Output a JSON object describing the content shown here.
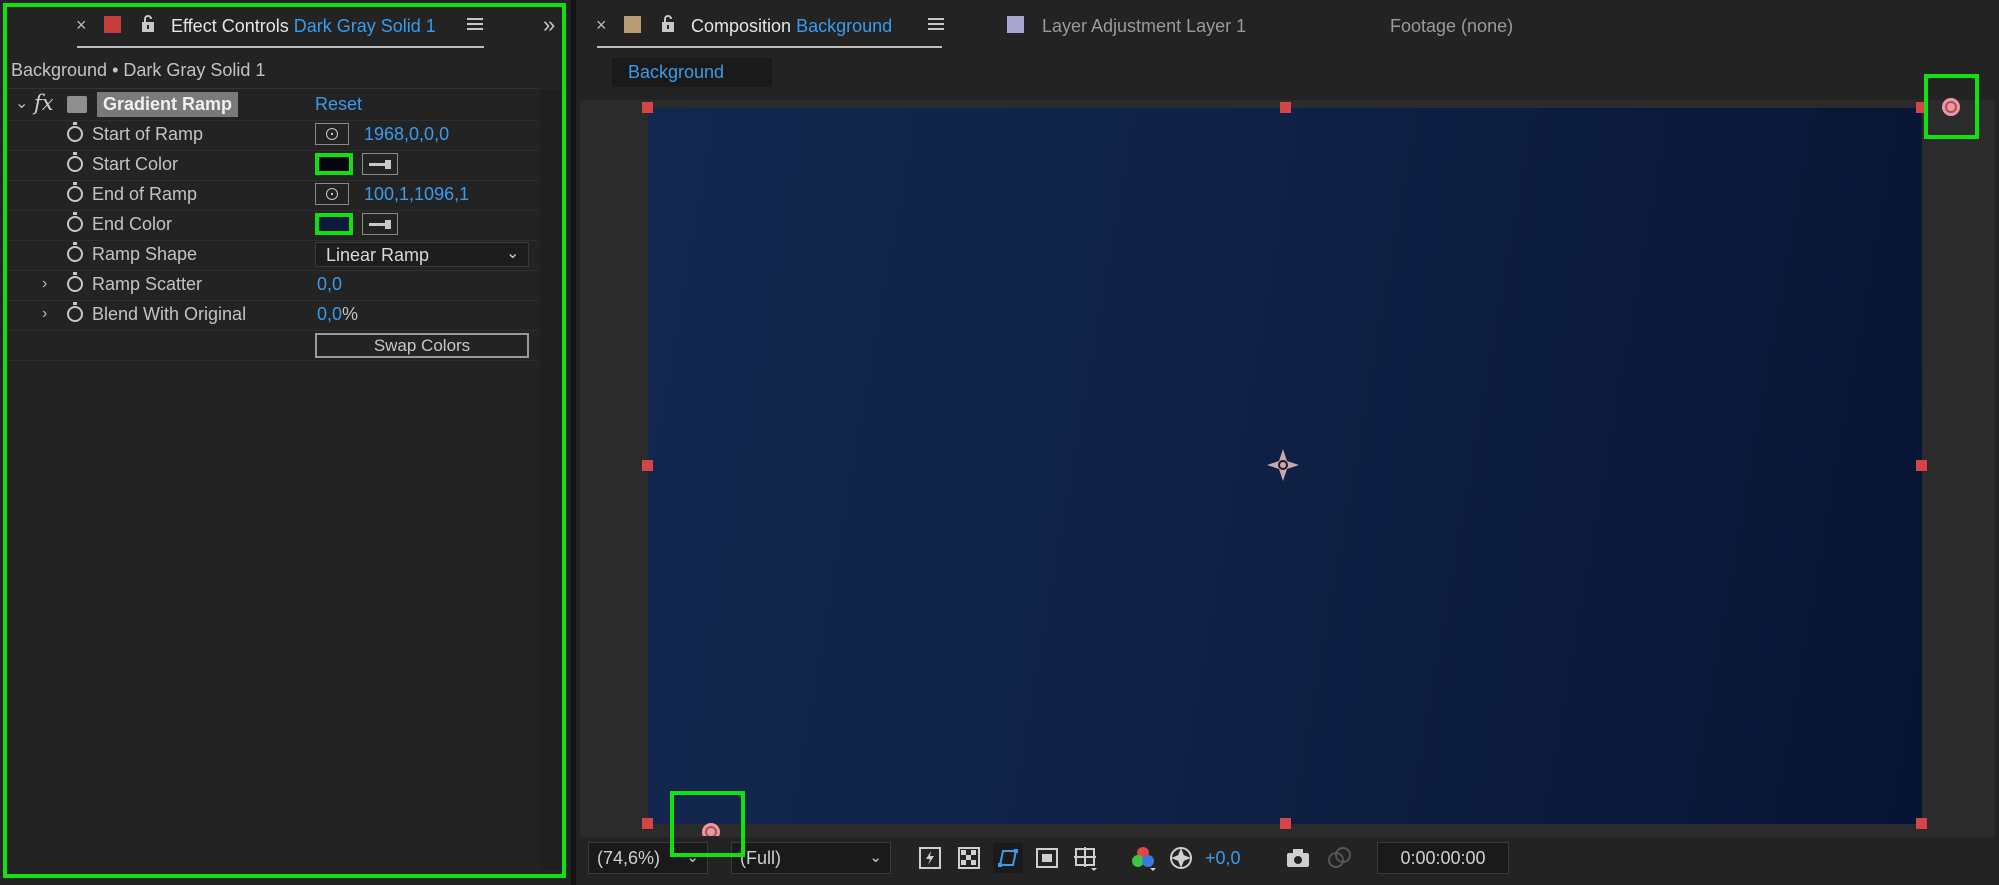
{
  "effect_controls": {
    "tab_title": "Effect Controls",
    "tab_layer": "Dark Gray Solid 1",
    "breadcrumb": "Background • Dark Gray Solid 1",
    "effect_name": "Gradient Ramp",
    "reset_label": "Reset",
    "properties": [
      {
        "label": "Start of Ramp",
        "value": "1968,0,0,0"
      },
      {
        "label": "Start Color",
        "color": "#05060d"
      },
      {
        "label": "End of Ramp",
        "value": "100,1,1096,1"
      },
      {
        "label": "End Color",
        "color": "#0c1a3b"
      },
      {
        "label": "Ramp Shape",
        "value": "Linear Ramp"
      },
      {
        "label": "Ramp Scatter",
        "value": "0,0"
      },
      {
        "label": "Blend With Original",
        "value": "0,0",
        "unit": "%"
      }
    ],
    "swap_colors_label": "Swap Colors"
  },
  "composition": {
    "tab_title": "Composition",
    "tab_comp": "Background",
    "layer_tab": "Layer Adjustment Layer 1",
    "footage_tab": "Footage (none)",
    "comp_chip": "Background"
  },
  "toolbar": {
    "zoom": "(74,6%)",
    "resolution": "(Full)",
    "exposure": "+0,0",
    "timecode": "0:00:00:00"
  },
  "colors": {
    "accent": "#3a9bea",
    "highlight": "#11e011",
    "handle": "#d64545"
  }
}
